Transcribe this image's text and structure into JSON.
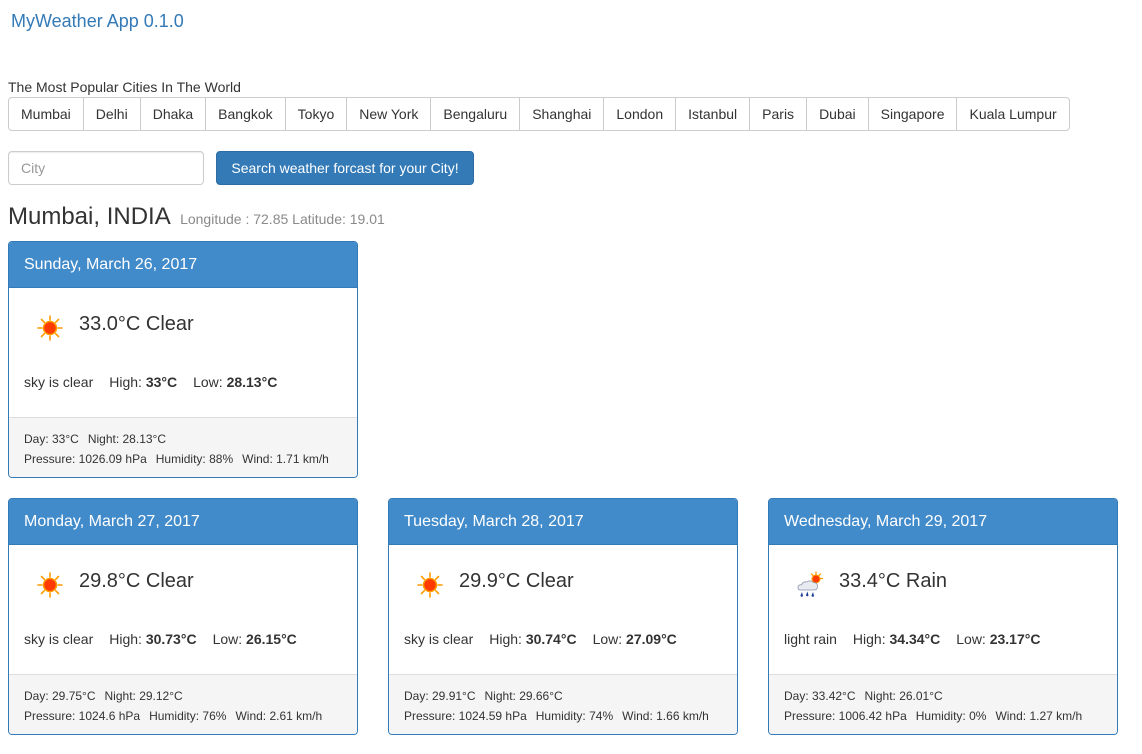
{
  "app": {
    "title": "MyWeather App 0.1.0"
  },
  "popular": {
    "label": "The Most Popular Cities In The World",
    "cities": [
      "Mumbai",
      "Delhi",
      "Dhaka",
      "Bangkok",
      "Tokyo",
      "New York",
      "Bengaluru",
      "Shanghai",
      "London",
      "Istanbul",
      "Paris",
      "Dubai",
      "Singapore",
      "Kuala Lumpur"
    ]
  },
  "search": {
    "placeholder": "City",
    "value": "",
    "button_label": "Search weather forcast for your City!"
  },
  "location": {
    "name": "Mumbai, INDIA",
    "coords": "Longitude : 72.85 Latitude: 19.01"
  },
  "forecast": [
    {
      "date": "Sunday, March 26, 2017",
      "icon": "sun-icon",
      "summary": "33.0°C Clear",
      "description": "sky is clear",
      "high_label": "High:",
      "high": "33°C",
      "low_label": "Low:",
      "low": "28.13°C",
      "day": "Day: 33°C",
      "night": "Night: 28.13°C",
      "pressure": "Pressure: 1026.09 hPa",
      "humidity": "Humidity: 88%",
      "wind": "Wind: 1.71 km/h"
    },
    {
      "date": "Monday, March 27, 2017",
      "icon": "sun-icon",
      "summary": "29.8°C Clear",
      "description": "sky is clear",
      "high_label": "High:",
      "high": "30.73°C",
      "low_label": "Low:",
      "low": "26.15°C",
      "day": "Day: 29.75°C",
      "night": "Night: 29.12°C",
      "pressure": "Pressure: 1024.6 hPa",
      "humidity": "Humidity: 76%",
      "wind": "Wind: 2.61 km/h"
    },
    {
      "date": "Tuesday, March 28, 2017",
      "icon": "sun-icon",
      "summary": "29.9°C Clear",
      "description": "sky is clear",
      "high_label": "High:",
      "high": "30.74°C",
      "low_label": "Low:",
      "low": "27.09°C",
      "day": "Day: 29.91°C",
      "night": "Night: 29.66°C",
      "pressure": "Pressure: 1024.59 hPa",
      "humidity": "Humidity: 74%",
      "wind": "Wind: 1.66 km/h"
    },
    {
      "date": "Wednesday, March 29, 2017",
      "icon": "rain-cloud-icon",
      "summary": "33.4°C Rain",
      "description": "light rain",
      "high_label": "High:",
      "high": "34.34°C",
      "low_label": "Low:",
      "low": "23.17°C",
      "day": "Day: 33.42°C",
      "night": "Night: 26.01°C",
      "pressure": "Pressure: 1006.42 hPa",
      "humidity": "Humidity: 0%",
      "wind": "Wind: 1.27 km/h"
    }
  ],
  "colors": {
    "primary": "#337ab7",
    "card_header": "#428bca",
    "sun": "#ff3b00"
  }
}
